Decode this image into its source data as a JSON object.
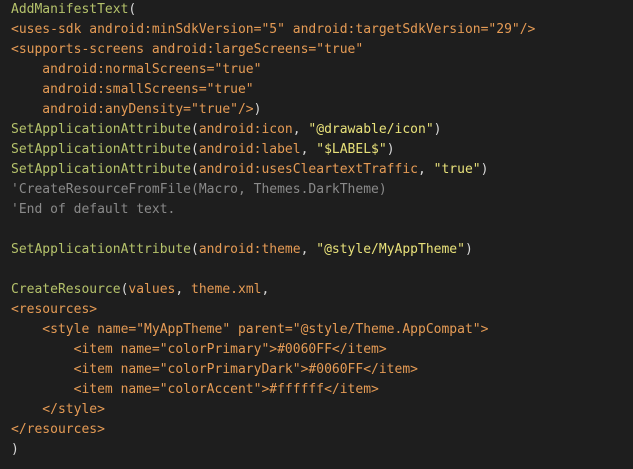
{
  "colors": {
    "background": "#1e1e1e",
    "default": "#d4d4d4",
    "function": "#b5c26b",
    "punct": "#d8d8d8",
    "tag": "#e59b55",
    "string": "#e8e17a",
    "comment": "#8a8a8a"
  },
  "lines": [
    [
      {
        "t": "AddManifestText",
        "c": "function"
      },
      {
        "t": "(",
        "c": "punct"
      }
    ],
    [
      {
        "t": "<uses-sdk android:minSdkVersion=\"5\" android:targetSdkVersion=\"29\"/>",
        "c": "tag"
      }
    ],
    [
      {
        "t": "<supports-screens android:largeScreens=\"true\"",
        "c": "tag"
      }
    ],
    [
      {
        "t": "    android:normalScreens=\"true\"",
        "c": "tag"
      }
    ],
    [
      {
        "t": "    android:smallScreens=\"true\"",
        "c": "tag"
      }
    ],
    [
      {
        "t": "    android:anyDensity=\"true\"/>",
        "c": "tag"
      },
      {
        "t": ")",
        "c": "punct"
      }
    ],
    [
      {
        "t": "SetApplicationAttribute",
        "c": "function"
      },
      {
        "t": "(",
        "c": "punct"
      },
      {
        "t": "android:icon",
        "c": "tag"
      },
      {
        "t": ", ",
        "c": "punct"
      },
      {
        "t": "\"@drawable/icon\"",
        "c": "string"
      },
      {
        "t": ")",
        "c": "punct"
      }
    ],
    [
      {
        "t": "SetApplicationAttribute",
        "c": "function"
      },
      {
        "t": "(",
        "c": "punct"
      },
      {
        "t": "android:label",
        "c": "tag"
      },
      {
        "t": ", ",
        "c": "punct"
      },
      {
        "t": "\"$LABEL$\"",
        "c": "string"
      },
      {
        "t": ")",
        "c": "punct"
      }
    ],
    [
      {
        "t": "SetApplicationAttribute",
        "c": "function"
      },
      {
        "t": "(",
        "c": "punct"
      },
      {
        "t": "android:usesCleartextTraffic",
        "c": "tag"
      },
      {
        "t": ", ",
        "c": "punct"
      },
      {
        "t": "\"true\"",
        "c": "string"
      },
      {
        "t": ")",
        "c": "punct"
      }
    ],
    [
      {
        "t": "'CreateResourceFromFile(Macro, Themes.DarkTheme)",
        "c": "comment"
      }
    ],
    [
      {
        "t": "'End of default text.",
        "c": "comment"
      }
    ],
    [],
    [
      {
        "t": "SetApplicationAttribute",
        "c": "function"
      },
      {
        "t": "(",
        "c": "punct"
      },
      {
        "t": "android:theme",
        "c": "tag"
      },
      {
        "t": ", ",
        "c": "punct"
      },
      {
        "t": "\"@style/MyAppTheme\"",
        "c": "string"
      },
      {
        "t": ")",
        "c": "punct"
      }
    ],
    [],
    [
      {
        "t": "CreateResource",
        "c": "function"
      },
      {
        "t": "(",
        "c": "punct"
      },
      {
        "t": "values",
        "c": "tag"
      },
      {
        "t": ", ",
        "c": "punct"
      },
      {
        "t": "theme.xml",
        "c": "tag"
      },
      {
        "t": ",",
        "c": "punct"
      }
    ],
    [
      {
        "t": "<resources>",
        "c": "tag"
      }
    ],
    [
      {
        "t": "    <style name=\"MyAppTheme\" parent=\"@style/Theme.AppCompat\">",
        "c": "tag"
      }
    ],
    [
      {
        "t": "        <item name=\"colorPrimary\">#0060FF</item>",
        "c": "tag"
      }
    ],
    [
      {
        "t": "        <item name=\"colorPrimaryDark\">#0060FF</item>",
        "c": "tag"
      }
    ],
    [
      {
        "t": "        <item name=\"colorAccent\">#ffffff</item>",
        "c": "tag"
      }
    ],
    [
      {
        "t": "    </style>",
        "c": "tag"
      }
    ],
    [
      {
        "t": "</resources>",
        "c": "tag"
      }
    ],
    [
      {
        "t": ")",
        "c": "punct"
      }
    ]
  ]
}
